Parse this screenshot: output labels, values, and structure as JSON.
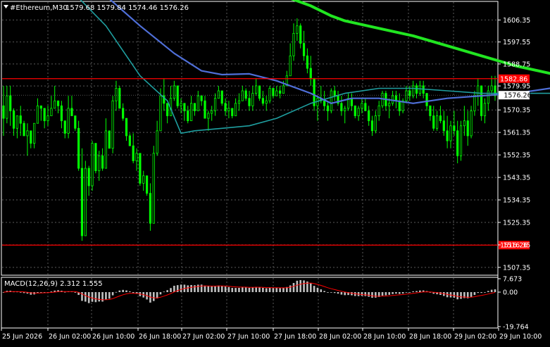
{
  "header": {
    "symbol_label": "#Ethereum,M30",
    "ohlc": "1579.68 1579.84 1574.46 1576.26"
  },
  "indicator": {
    "label": "MACD(12,26,9) 2.312 1.555"
  },
  "colors": {
    "background": "#000000",
    "frame": "#ffffff",
    "grid": "#5a5a5a",
    "candle": "#00ff00",
    "ma_fast": "#4f6fd8",
    "ma_mid": "#1f9fa0",
    "ma_slow": "#21e621",
    "level_line": "#ff0000",
    "price_tag_bg": "#ffffff",
    "macd_hist": "#c0c0c0",
    "macd_signal": "#ff0000",
    "text": "#ffffff"
  },
  "chart_data": {
    "type": "candlestick",
    "price_axis": {
      "ticks": [
        "1606.35",
        "1597.55",
        "1588.75",
        "1579.95",
        "1570.35",
        "1561.35",
        "1552.35",
        "1543.35",
        "1534.35",
        "1525.35",
        "1516.35",
        "1507.35"
      ]
    },
    "time_axis": {
      "ticks": [
        "25 Jun 2026",
        "26 Jun 02:00",
        "26 Jun 10:00",
        "26 Jun 18:00",
        "27 Jun 02:00",
        "27 Jun 10:00",
        "27 Jun 18:00",
        "28 Jun 02:00",
        "28 Jun 10:00",
        "28 Jun 18:00",
        "29 Jun 02:00",
        "29 Jun 10:00"
      ]
    },
    "current_price": "1576.26",
    "levels": [
      {
        "price": 1582.86,
        "label": "1582.86"
      },
      {
        "price": 1516.26,
        "label": "1516.26"
      }
    ],
    "moving_averages": {
      "slow": [
        [
          64,
          1619
        ],
        [
          80,
          1617
        ],
        [
          90,
          1612
        ],
        [
          96,
          1608
        ],
        [
          100,
          1606
        ],
        [
          110,
          1603
        ],
        [
          120,
          1600
        ],
        [
          130,
          1596
        ],
        [
          140,
          1592
        ],
        [
          150,
          1588
        ],
        [
          160,
          1585
        ],
        [
          170,
          1582
        ],
        [
          180,
          1580
        ],
        [
          190,
          1578
        ],
        [
          200,
          1577
        ],
        [
          208,
          1576.3
        ]
      ],
      "fast": [
        [
          0,
          1633
        ],
        [
          10,
          1630
        ],
        [
          20,
          1625
        ],
        [
          30,
          1616
        ],
        [
          40,
          1604
        ],
        [
          50,
          1593
        ],
        [
          58,
          1586
        ],
        [
          64,
          1584.5
        ],
        [
          72,
          1584.8
        ],
        [
          80,
          1582
        ],
        [
          90,
          1577
        ],
        [
          96,
          1573
        ],
        [
          102,
          1575
        ],
        [
          110,
          1575
        ],
        [
          120,
          1573
        ],
        [
          130,
          1575
        ],
        [
          140,
          1576
        ],
        [
          150,
          1577
        ],
        [
          160,
          1579
        ],
        [
          170,
          1580
        ],
        [
          180,
          1579
        ],
        [
          190,
          1578
        ],
        [
          200,
          1577.5
        ],
        [
          208,
          1577.5
        ]
      ],
      "mid": [
        [
          0,
          1630
        ],
        [
          10,
          1626
        ],
        [
          20,
          1618
        ],
        [
          30,
          1604
        ],
        [
          40,
          1584
        ],
        [
          48,
          1574
        ],
        [
          52,
          1561
        ],
        [
          56,
          1562
        ],
        [
          64,
          1563
        ],
        [
          72,
          1564
        ],
        [
          80,
          1567
        ],
        [
          90,
          1573
        ],
        [
          100,
          1577
        ],
        [
          110,
          1579
        ],
        [
          120,
          1579
        ],
        [
          130,
          1578
        ],
        [
          140,
          1577
        ],
        [
          150,
          1577
        ],
        [
          160,
          1577
        ],
        [
          170,
          1574
        ],
        [
          180,
          1572
        ],
        [
          190,
          1572
        ],
        [
          200,
          1574
        ],
        [
          208,
          1575
        ]
      ]
    },
    "candles": [
      [
        1572,
        1580,
        1560,
        1567
      ],
      [
        1567,
        1580,
        1565,
        1576
      ],
      [
        1576,
        1580,
        1564,
        1570
      ],
      [
        1570,
        1571,
        1560,
        1563
      ],
      [
        1563,
        1568,
        1559,
        1568
      ],
      [
        1568,
        1572,
        1560,
        1565
      ],
      [
        1565,
        1566,
        1560,
        1560
      ],
      [
        1560,
        1565,
        1552,
        1562
      ],
      [
        1562,
        1562,
        1555,
        1557
      ],
      [
        1557,
        1565,
        1555,
        1565
      ],
      [
        1565,
        1575,
        1565,
        1572
      ],
      [
        1572,
        1572,
        1566,
        1571
      ],
      [
        1571,
        1571,
        1563,
        1566
      ],
      [
        1566,
        1572,
        1564,
        1568
      ],
      [
        1568,
        1576,
        1568,
        1571
      ],
      [
        1571,
        1580,
        1571,
        1574
      ],
      [
        1574,
        1574,
        1569,
        1572
      ],
      [
        1572,
        1574,
        1563,
        1566
      ],
      [
        1566,
        1566,
        1559,
        1561
      ],
      [
        1561,
        1576,
        1559,
        1571
      ],
      [
        1571,
        1576,
        1568,
        1568
      ],
      [
        1568,
        1568,
        1562,
        1563
      ],
      [
        1563,
        1566,
        1546,
        1547
      ],
      [
        1547,
        1555,
        1518,
        1520
      ],
      [
        1520,
        1550,
        1520,
        1547
      ],
      [
        1547,
        1548,
        1536,
        1540
      ],
      [
        1540,
        1558,
        1538,
        1557
      ],
      [
        1557,
        1557,
        1545,
        1546
      ],
      [
        1546,
        1554,
        1542,
        1552
      ],
      [
        1552,
        1555,
        1546,
        1547
      ],
      [
        1547,
        1567,
        1547,
        1562
      ],
      [
        1562,
        1562,
        1555,
        1555
      ],
      [
        1555,
        1576,
        1553,
        1574
      ],
      [
        1574,
        1582,
        1570,
        1579
      ],
      [
        1579,
        1580,
        1571,
        1571
      ],
      [
        1571,
        1573,
        1566,
        1567
      ],
      [
        1567,
        1567,
        1558,
        1560
      ],
      [
        1560,
        1561,
        1556,
        1556
      ],
      [
        1556,
        1561,
        1549,
        1550
      ],
      [
        1550,
        1555,
        1546,
        1553
      ],
      [
        1553,
        1553,
        1540,
        1541
      ],
      [
        1541,
        1546,
        1538,
        1544
      ],
      [
        1544,
        1544,
        1536,
        1537
      ],
      [
        1537,
        1541,
        1522,
        1525
      ],
      [
        1525,
        1556,
        1525,
        1553
      ],
      [
        1553,
        1566,
        1552,
        1562
      ],
      [
        1562,
        1579,
        1562,
        1576
      ],
      [
        1576,
        1583,
        1570,
        1573
      ],
      [
        1573,
        1573,
        1565,
        1568
      ],
      [
        1568,
        1580,
        1568,
        1575
      ],
      [
        1575,
        1582,
        1574,
        1580
      ],
      [
        1580,
        1580,
        1571,
        1572
      ],
      [
        1572,
        1575,
        1569,
        1573
      ],
      [
        1573,
        1573,
        1566,
        1570
      ],
      [
        1570,
        1572,
        1565,
        1566
      ],
      [
        1566,
        1576,
        1566,
        1573
      ],
      [
        1573,
        1573,
        1568,
        1570
      ],
      [
        1570,
        1578,
        1570,
        1576
      ],
      [
        1576,
        1576,
        1572,
        1574
      ],
      [
        1574,
        1576,
        1567,
        1567
      ],
      [
        1567,
        1570,
        1562,
        1569
      ],
      [
        1569,
        1572,
        1566,
        1570
      ],
      [
        1570,
        1577,
        1568,
        1575
      ],
      [
        1575,
        1580,
        1575,
        1578
      ],
      [
        1578,
        1578,
        1572,
        1573
      ],
      [
        1573,
        1575,
        1568,
        1570
      ],
      [
        1570,
        1574,
        1567,
        1571
      ],
      [
        1571,
        1571,
        1567,
        1568
      ],
      [
        1568,
        1575,
        1568,
        1573
      ],
      [
        1573,
        1577,
        1570,
        1574
      ],
      [
        1574,
        1580,
        1574,
        1578
      ],
      [
        1578,
        1579,
        1574,
        1575
      ],
      [
        1575,
        1578,
        1570,
        1572
      ],
      [
        1572,
        1580,
        1570,
        1577
      ],
      [
        1577,
        1583,
        1576,
        1580
      ],
      [
        1580,
        1580,
        1574,
        1575
      ],
      [
        1575,
        1578,
        1572,
        1573
      ],
      [
        1573,
        1576,
        1570,
        1574
      ],
      [
        1574,
        1580,
        1573,
        1579
      ],
      [
        1579,
        1579,
        1575,
        1576
      ],
      [
        1576,
        1580,
        1576,
        1578
      ],
      [
        1578,
        1580,
        1575,
        1577
      ],
      [
        1577,
        1582,
        1577,
        1580
      ],
      [
        1580,
        1586,
        1580,
        1584
      ],
      [
        1584,
        1597,
        1584,
        1592
      ],
      [
        1592,
        1605,
        1590,
        1601
      ],
      [
        1601,
        1607,
        1598,
        1604
      ],
      [
        1604,
        1605,
        1595,
        1597
      ],
      [
        1597,
        1602,
        1590,
        1592
      ],
      [
        1592,
        1595,
        1585,
        1587
      ],
      [
        1587,
        1592,
        1580,
        1583
      ],
      [
        1583,
        1583,
        1570,
        1572
      ],
      [
        1572,
        1576,
        1566,
        1575
      ],
      [
        1575,
        1580,
        1573,
        1574
      ],
      [
        1574,
        1578,
        1570,
        1572
      ],
      [
        1572,
        1574,
        1566,
        1570
      ],
      [
        1570,
        1579,
        1569,
        1578
      ],
      [
        1578,
        1580,
        1574,
        1576
      ],
      [
        1576,
        1578,
        1572,
        1573
      ],
      [
        1573,
        1576,
        1568,
        1570
      ],
      [
        1570,
        1572,
        1565,
        1571
      ],
      [
        1571,
        1577,
        1570,
        1575
      ],
      [
        1575,
        1577,
        1570,
        1572
      ],
      [
        1572,
        1572,
        1567,
        1568
      ],
      [
        1568,
        1572,
        1566,
        1571
      ],
      [
        1571,
        1575,
        1569,
        1573
      ],
      [
        1573,
        1575,
        1570,
        1570
      ],
      [
        1570,
        1572,
        1564,
        1566
      ],
      [
        1566,
        1568,
        1560,
        1562
      ],
      [
        1562,
        1570,
        1561,
        1568
      ],
      [
        1568,
        1574,
        1566,
        1572
      ],
      [
        1572,
        1578,
        1571,
        1577
      ],
      [
        1577,
        1578,
        1570,
        1572
      ],
      [
        1572,
        1575,
        1567,
        1573
      ],
      [
        1573,
        1578,
        1572,
        1576
      ],
      [
        1576,
        1578,
        1571,
        1574
      ],
      [
        1574,
        1577,
        1568,
        1570
      ],
      [
        1570,
        1575,
        1569,
        1574
      ],
      [
        1574,
        1580,
        1573,
        1578
      ],
      [
        1578,
        1580,
        1574,
        1576
      ],
      [
        1576,
        1582,
        1575,
        1580
      ],
      [
        1580,
        1581,
        1575,
        1577
      ],
      [
        1577,
        1582,
        1576,
        1580
      ],
      [
        1580,
        1582,
        1575,
        1577
      ],
      [
        1577,
        1577,
        1570,
        1572
      ],
      [
        1572,
        1572,
        1566,
        1568
      ],
      [
        1568,
        1572,
        1562,
        1563
      ],
      [
        1563,
        1570,
        1562,
        1568
      ],
      [
        1568,
        1572,
        1565,
        1566
      ],
      [
        1566,
        1570,
        1560,
        1562
      ],
      [
        1562,
        1568,
        1555,
        1558
      ],
      [
        1558,
        1566,
        1555,
        1564
      ],
      [
        1564,
        1570,
        1560,
        1562
      ],
      [
        1562,
        1566,
        1549,
        1552
      ],
      [
        1552,
        1566,
        1550,
        1564
      ],
      [
        1564,
        1572,
        1560,
        1566
      ],
      [
        1566,
        1570,
        1556,
        1560
      ],
      [
        1560,
        1572,
        1559,
        1570
      ],
      [
        1570,
        1578,
        1568,
        1576
      ],
      [
        1576,
        1583,
        1572,
        1580
      ],
      [
        1580,
        1580,
        1566,
        1568
      ],
      [
        1568,
        1575,
        1565,
        1573
      ],
      [
        1573,
        1580,
        1570,
        1578
      ],
      [
        1578,
        1584,
        1576,
        1580
      ],
      [
        1580,
        1584,
        1574,
        1576
      ]
    ],
    "macd": {
      "axis_ticks": [
        "7.673",
        "0.00",
        "-19.764"
      ],
      "range": [
        -19.764,
        7.673
      ]
    }
  }
}
